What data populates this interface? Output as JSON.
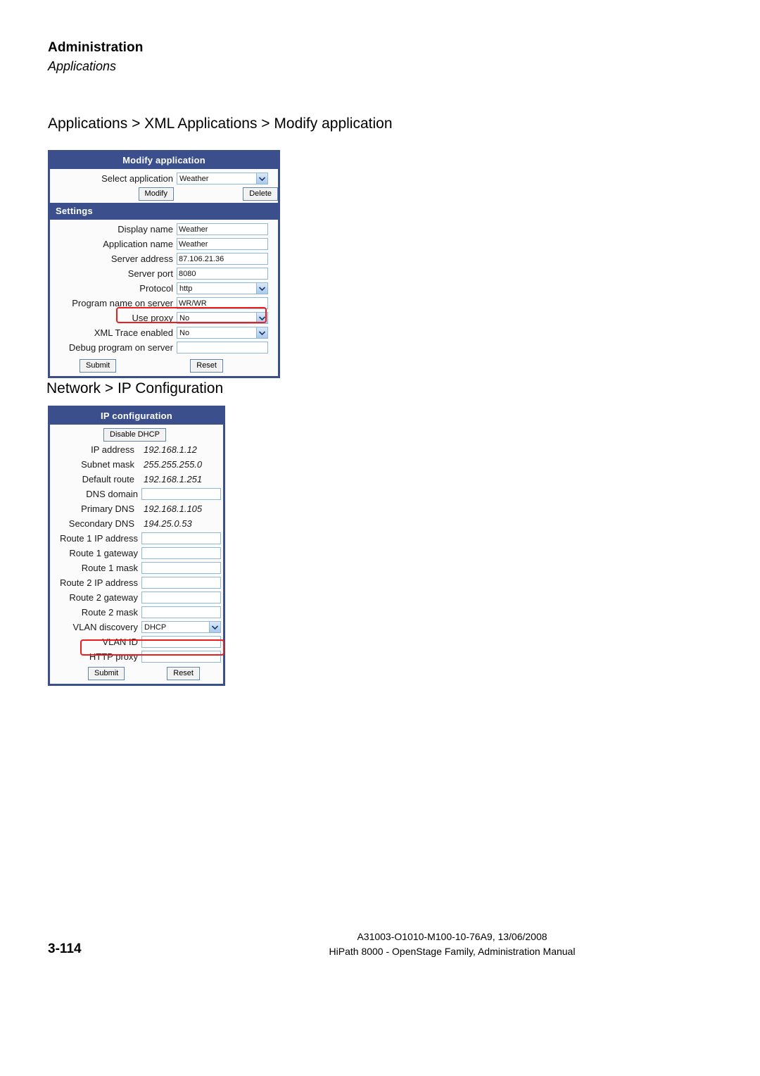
{
  "header": {
    "chapter": "Administration",
    "section": "Applications"
  },
  "headings": {
    "applications_path": "Applications > XML Applications > Modify application",
    "network_path": "Network > IP Configuration"
  },
  "modify_application_panel": {
    "title": "Modify application",
    "select_row": {
      "label": "Select application",
      "value": "Weather"
    },
    "buttons": {
      "modify": "Modify",
      "delete": "Delete",
      "submit": "Submit",
      "reset": "Reset"
    },
    "settings_bar": "Settings",
    "settings_rows": [
      {
        "label": "Display name",
        "value": "Weather",
        "type": "text"
      },
      {
        "label": "Application name",
        "value": "Weather",
        "type": "text"
      },
      {
        "label": "Server address",
        "value": "87.106.21.36",
        "type": "text"
      },
      {
        "label": "Server port",
        "value": "8080",
        "type": "text"
      },
      {
        "label": "Protocol",
        "value": "http",
        "type": "select"
      },
      {
        "label": "Program name on server",
        "value": "WR/WR",
        "type": "text"
      },
      {
        "label": "Use proxy",
        "value": "No",
        "type": "select",
        "highlighted": true
      },
      {
        "label": "XML Trace enabled",
        "value": "No",
        "type": "select"
      },
      {
        "label": "Debug program on server",
        "value": "",
        "type": "text"
      }
    ]
  },
  "ip_configuration_panel": {
    "title": "IP configuration",
    "buttons": {
      "disable_dhcp": "Disable DHCP",
      "submit": "Submit",
      "reset": "Reset"
    },
    "rows": [
      {
        "label": "IP address",
        "value": "192.168.1.12",
        "type": "static"
      },
      {
        "label": "Subnet mask",
        "value": "255.255.255.0",
        "type": "static"
      },
      {
        "label": "Default route",
        "value": "192.168.1.251",
        "type": "static"
      },
      {
        "label": "DNS domain",
        "value": "",
        "type": "text"
      },
      {
        "label": "Primary DNS",
        "value": "192.168.1.105",
        "type": "static"
      },
      {
        "label": "Secondary DNS",
        "value": "194.25.0.53",
        "type": "static"
      },
      {
        "label": "Route 1 IP address",
        "value": "",
        "type": "text"
      },
      {
        "label": "Route 1 gateway",
        "value": "",
        "type": "text"
      },
      {
        "label": "Route 1 mask",
        "value": "",
        "type": "text"
      },
      {
        "label": "Route 2 IP address",
        "value": "",
        "type": "text"
      },
      {
        "label": "Route 2 gateway",
        "value": "",
        "type": "text"
      },
      {
        "label": "Route 2 mask",
        "value": "",
        "type": "text"
      },
      {
        "label": "VLAN discovery",
        "value": "DHCP",
        "type": "select"
      },
      {
        "label": "VLAN ID",
        "value": "",
        "type": "text"
      },
      {
        "label": "HTTP proxy",
        "value": "",
        "type": "text",
        "highlighted": true
      }
    ]
  },
  "footer": {
    "page_number": "3-114",
    "doc_id": "A31003-O1010-M100-10-76A9, 13/06/2008",
    "doc_title": "HiPath 8000 - OpenStage Family, Administration Manual"
  },
  "colors": {
    "panel_navy": "#3a4f8b",
    "highlight_red": "#ef1c1c",
    "field_border": "#8fb8d8"
  }
}
